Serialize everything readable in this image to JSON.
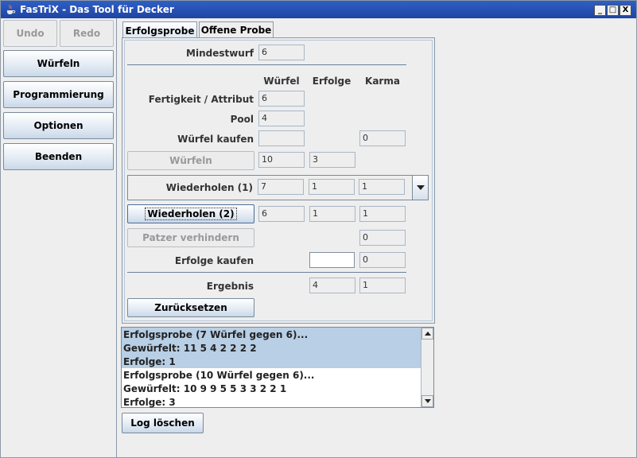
{
  "window": {
    "title": "FasTriX - Das Tool für Decker",
    "min_symbol": "_",
    "max_symbol": "□",
    "close_symbol": "X"
  },
  "sidebar": {
    "undo": "Undo",
    "redo": "Redo",
    "items": [
      "Würfeln",
      "Programmierung",
      "Optionen",
      "Beenden"
    ]
  },
  "tabs": [
    {
      "label": "Erfolgsprobe",
      "active": true
    },
    {
      "label": "Offene Probe",
      "active": false
    }
  ],
  "form": {
    "mindestwurf_label": "Mindestwurf",
    "mindestwurf_value": "6",
    "col_wuerfel": "Würfel",
    "col_erfolge": "Erfolge",
    "col_karma": "Karma",
    "fertigkeit_label": "Fertigkeit / Attribut",
    "fertigkeit_value": "6",
    "pool_label": "Pool",
    "pool_value": "4",
    "wuerfel_kaufen_label": "Würfel kaufen",
    "wuerfel_kaufen_value": "",
    "wuerfel_kaufen_karma": "0",
    "wuerfeln_button": "Würfeln",
    "wuerfeln_wuerfel": "10",
    "wuerfeln_erfolge": "3",
    "wiederholen1_label": "Wiederholen (1)",
    "wiederholen1_wuerfel": "7",
    "wiederholen1_erfolge": "1",
    "wiederholen1_karma": "1",
    "wiederholen2_button": "Wiederholen (2)",
    "wiederholen2_wuerfel": "6",
    "wiederholen2_erfolge": "1",
    "wiederholen2_karma": "1",
    "patzer_button": "Patzer verhindern",
    "patzer_karma": "0",
    "erfolge_kaufen_label": "Erfolge kaufen",
    "erfolge_kaufen_value": "",
    "erfolge_kaufen_karma": "0",
    "ergebnis_label": "Ergebnis",
    "ergebnis_erfolge": "4",
    "ergebnis_karma": "1",
    "reset_button": "Zurücksetzen"
  },
  "log": {
    "entries": [
      {
        "lines": [
          "Erfolgsprobe (7 Würfel gegen 6)...",
          "Gewürfelt:  11  5  4  2  2  2  2",
          "Erfolge: 1"
        ],
        "selected": true
      },
      {
        "lines": [
          "Erfolgsprobe (10 Würfel gegen 6)...",
          "Gewürfelt:  10  9  9  5  5  3  3  2  2  1",
          "Erfolge: 3"
        ],
        "selected": false
      }
    ],
    "clear_button": "Log löschen"
  }
}
